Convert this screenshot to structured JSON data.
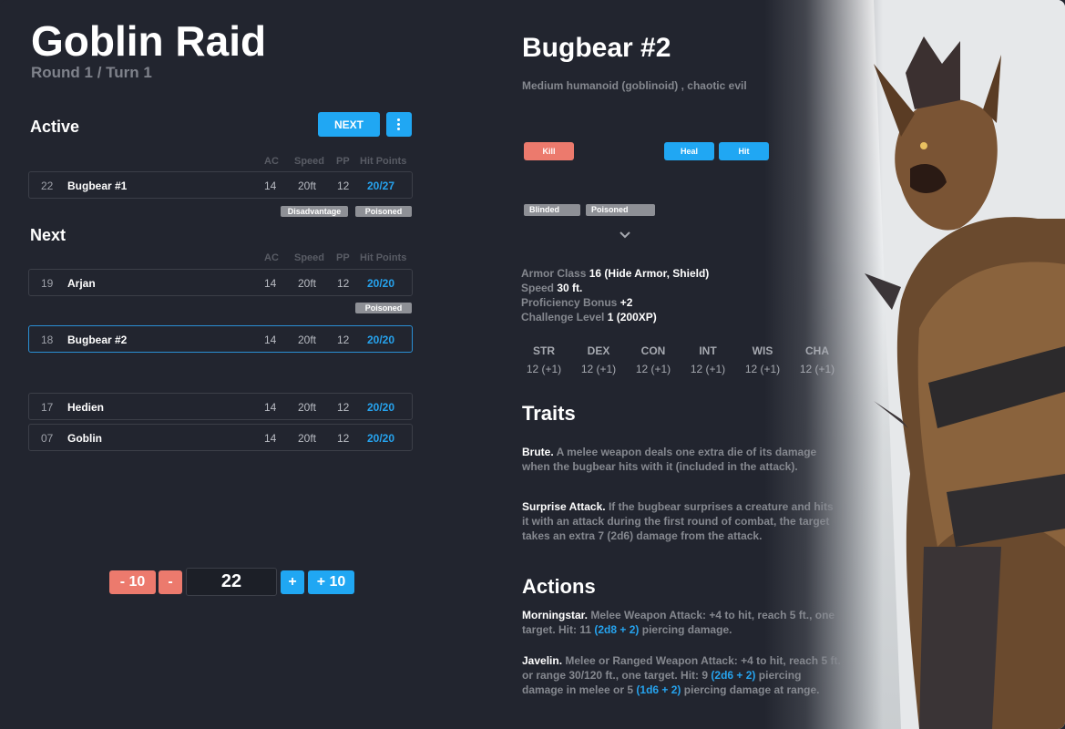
{
  "encounter": {
    "title": "Goblin Raid",
    "round_turn": "Round 1 / Turn 1"
  },
  "colors": {
    "accent": "#20a7f3",
    "danger": "#ec7a6d",
    "hp": "#26a3ee",
    "tag": "#8e9096",
    "background": "#22252f"
  },
  "active": {
    "heading": "Active",
    "next_label": "NEXT",
    "menu_icon": "more-vertical-icon",
    "columns": [
      "AC",
      "Speed",
      "PP",
      "Hit Points"
    ],
    "rows": [
      {
        "initiative": "22",
        "name": "Bugbear #1",
        "ac": "14",
        "speed": "20ft",
        "pp": "12",
        "hp": "20/27",
        "tags": [
          "Disadvantage",
          "Poisoned"
        ]
      }
    ]
  },
  "next": {
    "heading": "Next",
    "columns": [
      "AC",
      "Speed",
      "PP",
      "Hit Points"
    ],
    "rows": [
      {
        "initiative": "19",
        "name": "Arjan",
        "ac": "14",
        "speed": "20ft",
        "pp": "12",
        "hp": "20/20",
        "tags": [
          "Poisoned"
        ]
      },
      {
        "initiative": "18",
        "name": "Bugbear #2",
        "ac": "14",
        "speed": "20ft",
        "pp": "12",
        "hp": "20/20",
        "tags": []
      },
      {
        "initiative": "17",
        "name": "Hedien",
        "ac": "14",
        "speed": "20ft",
        "pp": "12",
        "hp": "20/20",
        "tags": []
      },
      {
        "initiative": "07",
        "name": "Goblin",
        "ac": "14",
        "speed": "20ft",
        "pp": "12",
        "hp": "20/20",
        "tags": []
      }
    ]
  },
  "stepper": {
    "minus10": "- 10",
    "minus1": "-",
    "value": "22",
    "plus1": "+",
    "plus10": "+ 10"
  },
  "detail": {
    "name": "Bugbear #2",
    "type": "Medium humanoid (goblinoid) , chaotic evil",
    "buttons": {
      "kill": "Kill",
      "heal": "Heal",
      "hit": "Hit"
    },
    "conditions": [
      "Blinded",
      "Poisoned"
    ],
    "expand_icon": "chevron-down-icon",
    "props": [
      {
        "label": "Armor Class",
        "value": "16 (Hide Armor, Shield)"
      },
      {
        "label": "Speed",
        "value": "30 ft."
      },
      {
        "label": "Proficiency Bonus",
        "value": "+2"
      },
      {
        "label": "Challenge Level",
        "value": "1 (200XP)"
      }
    ],
    "abilities": [
      {
        "name": "STR",
        "score": "12 (+1)"
      },
      {
        "name": "DEX",
        "score": "12 (+1)"
      },
      {
        "name": "CON",
        "score": "12 (+1)"
      },
      {
        "name": "INT",
        "score": "12 (+1)"
      },
      {
        "name": "WIS",
        "score": "12 (+1)"
      },
      {
        "name": "CHA",
        "score": "12 (+1)"
      }
    ],
    "traits_heading": "Traits",
    "traits": [
      {
        "name": "Brute.",
        "text": "A melee weapon deals one extra die of its damage when the bugbear hits with it (included in the attack)."
      },
      {
        "name": "Surprise Attack.",
        "text": "If the bugbear surprises a creature and hits it with an attack during the first round of combat, the target takes an extra 7 (2d6) damage from the attack."
      }
    ],
    "actions_heading": "Actions",
    "actions": [
      {
        "name": "Morningstar.",
        "pre": "Melee Weapon Attack: +4 to hit, reach 5 ft., one target. Hit: 11",
        "dice1": "(2d8 + 2)",
        "mid": "piercing damage.",
        "dice2": "",
        "post": ""
      },
      {
        "name": "Javelin.",
        "pre": "Melee or Ranged Weapon Attack: +4 to hit, reach 5 ft. or range 30/120 ft., one target. Hit: 9",
        "dice1": "(2d6 + 2)",
        "mid": "piercing damage in melee or 5",
        "dice2": "(1d6 + 2)",
        "post": "piercing damage at range."
      }
    ]
  }
}
